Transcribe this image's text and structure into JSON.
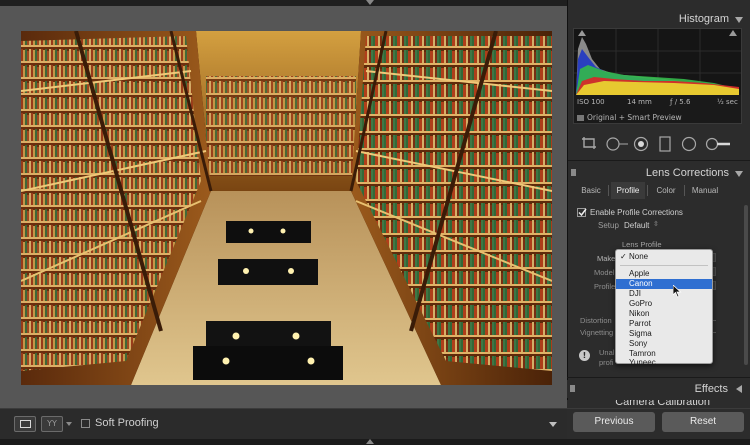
{
  "viewer": {
    "photo_alt": "Rijksmuseum library interior, viewed from above"
  },
  "toolbar": {
    "compare_label": "YY",
    "soft_proofing_label": "Soft Proofing",
    "soft_proofing_checked": false
  },
  "histogram": {
    "title": "Histogram",
    "iso": "ISO 100",
    "focal_length": "14 mm",
    "aperture": "ƒ / 5.6",
    "shutter": "½ sec",
    "preview_label": "Original + Smart Preview"
  },
  "lens_corrections": {
    "title": "Lens Corrections",
    "tabs": [
      {
        "label": "Basic",
        "active": false
      },
      {
        "label": "Profile",
        "active": true
      },
      {
        "label": "Color",
        "active": false
      },
      {
        "label": "Manual",
        "active": false
      }
    ],
    "enable_label": "Enable Profile Corrections",
    "enable_checked": true,
    "setup_label": "Setup",
    "setup_value": "Default",
    "lens_profile_heading": "Lens Profile",
    "make_label": "Make",
    "model_label": "Model",
    "profile_label": "Profile",
    "distortion_label": "Distortion",
    "vignetting_label": "Vignetting",
    "notice_line1": "Unal",
    "notice_line2": "profi"
  },
  "make_dropdown": {
    "checked_item": "None",
    "selected_item": "Canon",
    "items": [
      "None",
      "Apple",
      "Canon",
      "DJI",
      "GoPro",
      "Nikon",
      "Parrot",
      "Sigma",
      "Sony",
      "Tamron",
      "Yuneec"
    ]
  },
  "effects": {
    "title": "Effects"
  },
  "camera_calibration": {
    "title": "Camera Calibration"
  },
  "buttons": {
    "previous": "Previous",
    "reset": "Reset"
  },
  "colors": {
    "selection_blue": "#2f6fd1",
    "panel_bg": "#2c2c2c",
    "viewer_bg": "#565656"
  }
}
